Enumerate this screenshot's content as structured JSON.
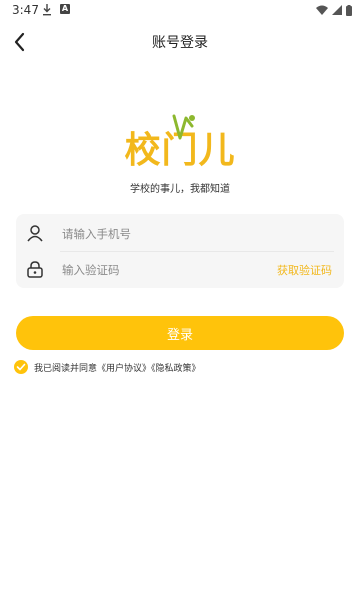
{
  "status_bar": {
    "time": "3:47",
    "badge_letter": "A"
  },
  "header": {
    "title": "账号登录"
  },
  "brand": {
    "logo_text": "校门儿",
    "slogan": "学校的事儿，我都知道",
    "logo_green": "#8db82f",
    "logo_yellow": "#f2b81c"
  },
  "form": {
    "phone_placeholder": "请输入手机号",
    "code_placeholder": "输入验证码",
    "get_code_label": "获取验证码"
  },
  "login_button": {
    "label": "登录"
  },
  "agreement": {
    "checked": true,
    "prefix": "我已阅读并同意",
    "user_agreement": "《用户协议》",
    "privacy_policy": "《隐私政策》"
  },
  "colors": {
    "accent": "#ffc30b",
    "link": "#f2b81c",
    "card_bg": "#f6f6f6"
  }
}
